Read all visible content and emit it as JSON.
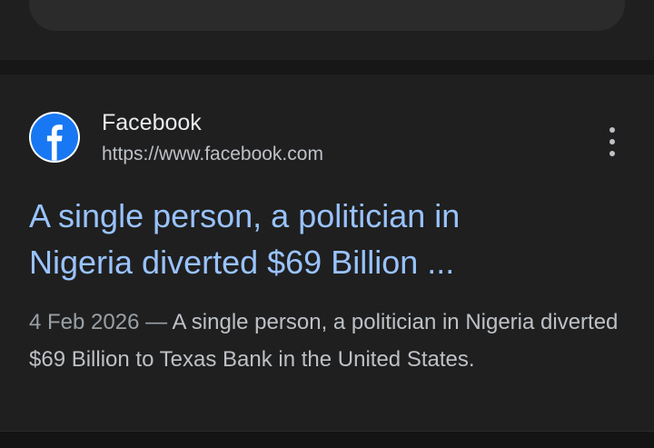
{
  "result": {
    "site_name": "Facebook",
    "site_url": "https://www.facebook.com",
    "favicon": "facebook-logo",
    "title_line1": "A single person, a politician in",
    "title_line2": "Nigeria diverted $69 Billion ...",
    "date": "4 Feb 2026",
    "separator": " — ",
    "snippet": "A single person, a politician in Nigeria diverted $69 Billion to Texas Bank in the United States.",
    "menu_icon": "more-vert-icon"
  },
  "colors": {
    "background": "#1f1f1f",
    "title_link": "#99c3ff",
    "text_primary": "#e8eaed",
    "text_secondary": "#bdc1c6",
    "facebook_blue": "#1877f2"
  }
}
